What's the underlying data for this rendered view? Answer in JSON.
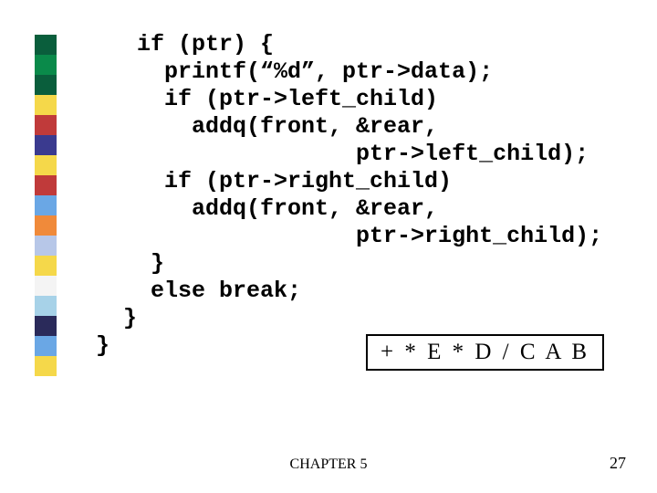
{
  "sidebar_colors": [
    "#0a5e3c",
    "#0a8a4a",
    "#0a5e3c",
    "#f5d84a",
    "#c03a3a",
    "#3a3a8f",
    "#f5d84a",
    "#c03a3a",
    "#6aa7e5",
    "#f08a3a",
    "#b7c7e8",
    "#f5d84a",
    "#f4f4f4",
    "#a7d2e8",
    "#2a2a5a",
    "#6aa7e5",
    "#f5d84a"
  ],
  "code_lines": [
    "   if (ptr) {",
    "     printf(“%d”, ptr->data);",
    "     if (ptr->left_child)",
    "       addq(front, &rear,",
    "                   ptr->left_child);",
    "     if (ptr->right_child)",
    "       addq(front, &rear,",
    "                   ptr->right_child);",
    "    }",
    "    else break;",
    "  }",
    "}"
  ],
  "box_text": "+ * E * D / C A B",
  "footer": {
    "center": "CHAPTER 5",
    "right": "27"
  }
}
